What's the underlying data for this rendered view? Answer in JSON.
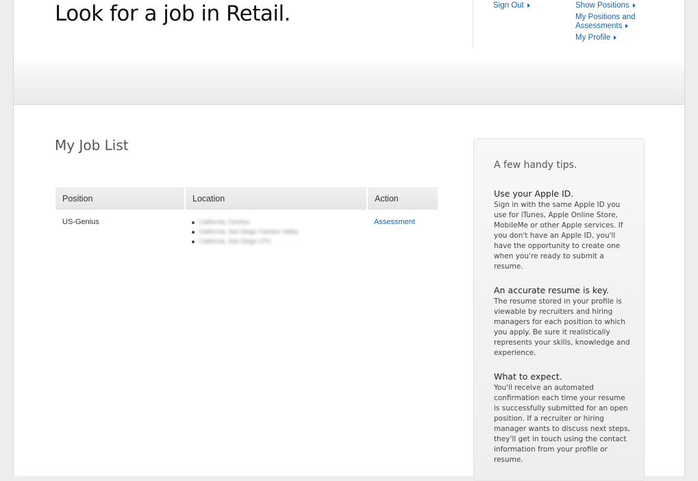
{
  "header": {
    "title": "Look for a job in Retail.",
    "nav": {
      "sign_out": "Sign Out",
      "show_positions": "Show Positions",
      "my_positions_line1": "My Positions and",
      "my_positions_line2": "Assessments",
      "my_profile": "My Profile"
    }
  },
  "job_list": {
    "title": "My Job List",
    "columns": [
      "Position",
      "Location",
      "Action"
    ],
    "rows": [
      {
        "position": "US-Genius",
        "locations": [
          "California, Cerritos",
          "California, San Diego Fashion Valley",
          "California, San Diego UTC"
        ],
        "action": "Assessment"
      }
    ]
  },
  "tips": {
    "title": "A few handy tips.",
    "items": [
      {
        "heading": "Use your Apple ID.",
        "body": "Sign in with the same Apple ID you use for iTunes, Apple Online Store, MobileMe or other Apple services. If you don't have an Apple ID, you'll have the opportunity to create one when you're ready to submit a resume."
      },
      {
        "heading": "An accurate resume is key.",
        "body": "The resume stored in your profile is viewable by recruiters and hiring managers for each position to which you apply. Be sure it realistically represents your skills, knowledge and experience."
      },
      {
        "heading": "What to expect.",
        "body": "You'll receive an automated confirmation each time your resume is successfully submitted for an open position. If a recruiter or hiring manager wants to discuss next steps, they'll get in touch using the contact information from your profile or resume."
      }
    ]
  },
  "colors": {
    "link": "#0f64b4",
    "title": "#111111",
    "subtitle": "#555555"
  }
}
